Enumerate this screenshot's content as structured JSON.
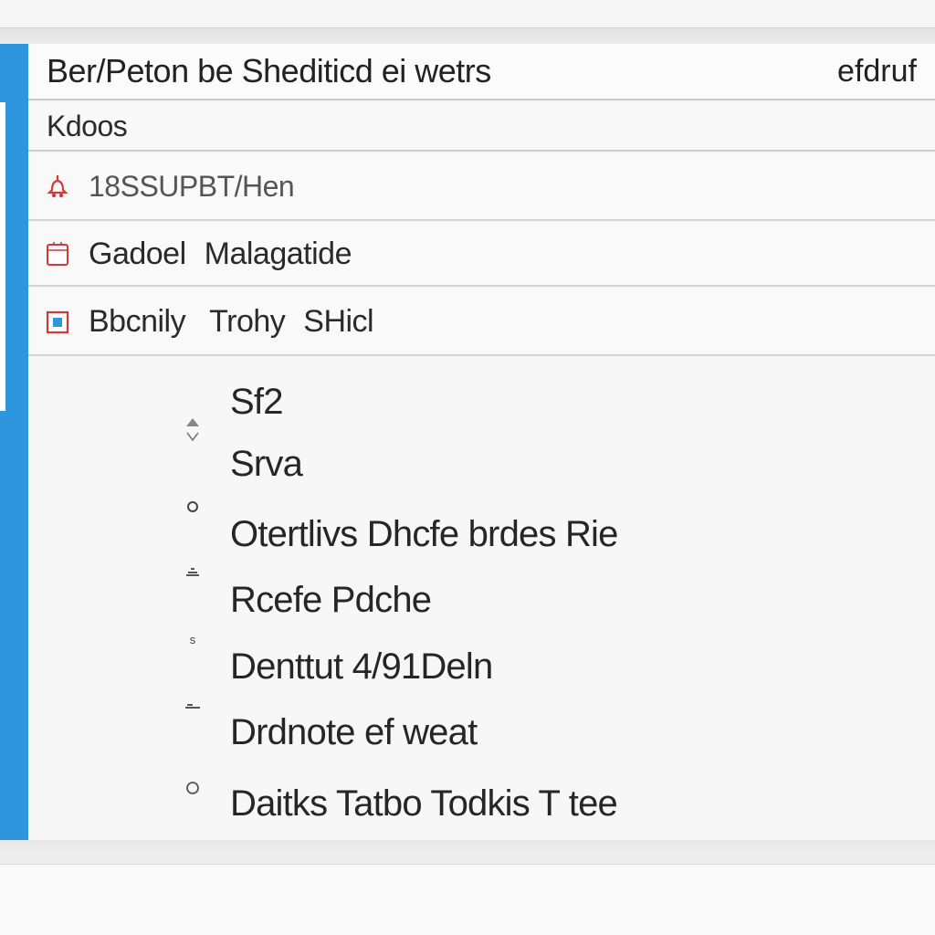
{
  "header": {
    "title": "Ber/Peton be Shediticd ei wetrs",
    "right": "efdruf"
  },
  "section": {
    "title": "Kdoos"
  },
  "items": [
    {
      "label": "18SSUPBT/Hen",
      "icon": "bell-icon"
    },
    {
      "label_a": "Gadoel",
      "label_b": "Malagatide",
      "icon": "document-icon"
    },
    {
      "label_a": "Bbcnily",
      "label_b": "Trohy",
      "label_c": "SHicl",
      "icon": "image-icon"
    }
  ],
  "menu": [
    {
      "label": "Sf2",
      "icon": "sort-arrows-icon"
    },
    {
      "label": "Srva",
      "icon": ""
    },
    {
      "label": "Otertlivs Dhcfe brdes Rie",
      "icon": "circle-icon"
    },
    {
      "label": "Rcefe Pdche",
      "icon": "small-glyph-icon"
    },
    {
      "label": "Denttut 4/91Deln",
      "icon": "s-glyph-icon"
    },
    {
      "label": "Drdnote ef weat",
      "icon": "circle-icon"
    },
    {
      "label": "Daitks Tatbo Todkis T tee",
      "icon": "small-glyph-icon"
    }
  ],
  "colors": {
    "accent": "#2d96dc",
    "icon_red": "#d23a3a"
  }
}
